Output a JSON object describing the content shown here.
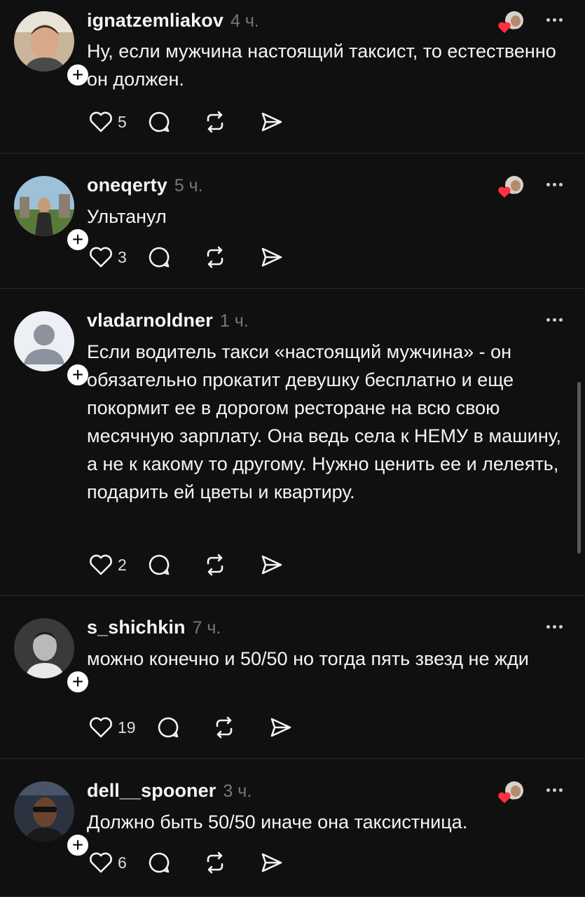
{
  "comments": [
    {
      "username": "ignatzemliakov",
      "time": "4 ч.",
      "text": "Ну, если мужчина настоящий таксист, то естественно он должен.",
      "likes": "5",
      "liked_by_author": true,
      "avatar_icon": "user-photo"
    },
    {
      "username": "oneqerty",
      "time": "5 ч.",
      "text": "Ультанул",
      "likes": "3",
      "liked_by_author": true,
      "avatar_icon": "user-photo"
    },
    {
      "username": "vladarnoldner",
      "time": "1 ч.",
      "text": "Если водитель такси «настоящий мужчина» - он обязательно прокатит девушку бесплатно и еще покормит ее в дорогом ресторане на всю свою месячную зарплату. Она ведь села к НЕМУ в машину, а не к какому то другому. Нужно ценить ее и лелеять, подарить ей цветы и квартиру.",
      "likes": "2",
      "liked_by_author": false,
      "avatar_icon": "default-avatar"
    },
    {
      "username": "s_shichkin",
      "time": "7 ч.",
      "text": "можно конечно и 50/50 но тогда пять звезд не жди",
      "likes": "19",
      "liked_by_author": false,
      "avatar_icon": "user-photo"
    },
    {
      "username": "dell__spooner",
      "time": "3 ч.",
      "text": "Должно быть 50/50 иначе она таксистница.",
      "likes": "6",
      "liked_by_author": true,
      "avatar_icon": "user-photo"
    }
  ],
  "icons": {
    "like": "heart-outline-icon",
    "reply": "comment-bubble-icon",
    "repost": "repost-icon",
    "share": "send-icon",
    "more": "more-dots-icon",
    "follow": "plus-icon"
  },
  "colors": {
    "background": "#101010",
    "text": "#f3f5f7",
    "muted": "#777777",
    "heart": "#ff3040"
  }
}
